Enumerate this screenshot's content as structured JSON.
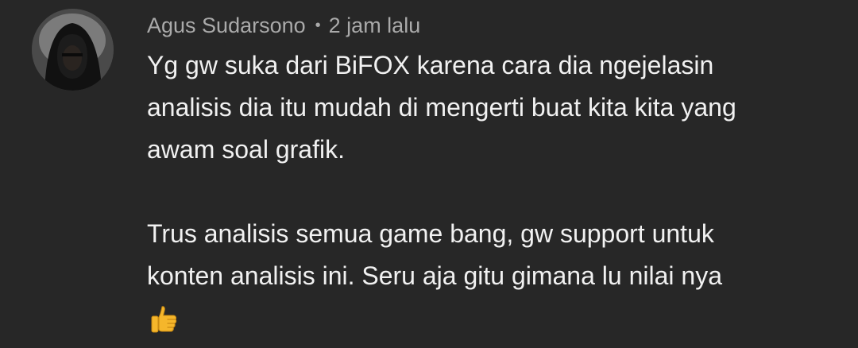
{
  "comment": {
    "author": "Agus Sudarsono",
    "separator": "•",
    "time": "2 jam lalu",
    "paragraphs": [
      {
        "lines": [
          "Yg gw suka dari BiFOX karena cara dia ngejelasin",
          "analisis dia itu mudah di mengerti buat kita kita yang",
          "awam soal grafik."
        ]
      },
      {
        "lines": [
          "Trus analisis semua game bang, gw support untuk",
          "konten analisis ini. Seru aja gitu gimana lu nilai nya"
        ]
      }
    ],
    "emoji": "thumbs-up-icon"
  },
  "colors": {
    "background": "#272727",
    "author_text": "#aaaaaa",
    "body_text": "#f1f1f1",
    "emoji": "#f5b62b"
  }
}
